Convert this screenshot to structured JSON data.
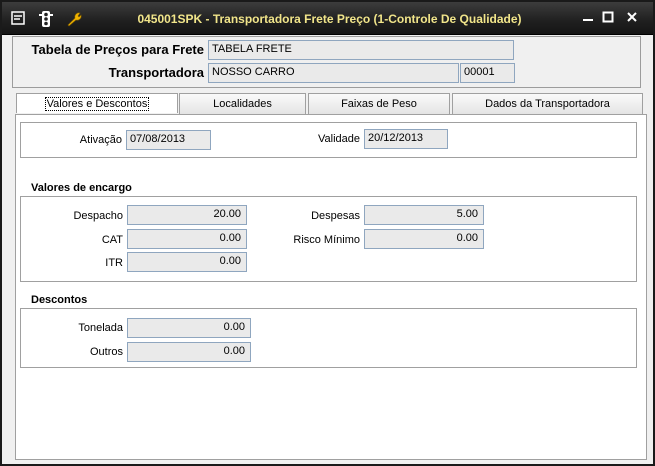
{
  "window": {
    "title": "045001SPK - Transportadora Frete Preço (1-Controle De Qualidade)",
    "icons": [
      "menu-icon",
      "traffic-light-icon",
      "wrench-icon"
    ]
  },
  "header": {
    "tabela_label": "Tabela de Preços para Frete",
    "tabela_value": "TABELA FRETE",
    "transportadora_label": "Transportadora",
    "transportadora_value": "NOSSO CARRO",
    "transportadora_code": "00001"
  },
  "tabs": [
    "Valores e Descontos",
    "Localidades",
    "Faixas de Peso",
    "Dados da Transportadora"
  ],
  "dates": {
    "ativacao_label": "Ativação",
    "ativacao_value": "07/08/2013",
    "validade_label": "Validade",
    "validade_value": "20/12/2013"
  },
  "encargo": {
    "title": "Valores de encargo",
    "despacho_label": "Despacho",
    "despacho_value": "20.00",
    "despesas_label": "Despesas",
    "despesas_value": "5.00",
    "cat_label": "CAT",
    "cat_value": "0.00",
    "risco_label": "Risco Mínimo",
    "risco_value": "0.00",
    "itr_label": "ITR",
    "itr_value": "0.00"
  },
  "descontos": {
    "title": "Descontos",
    "tonelada_label": "Tonelada",
    "tonelada_value": "0.00",
    "outros_label": "Outros",
    "outros_value": "0.00"
  }
}
